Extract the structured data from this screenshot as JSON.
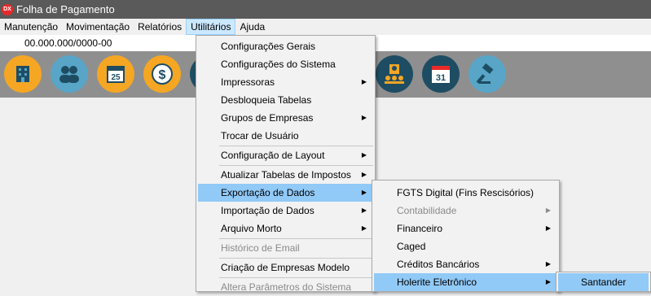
{
  "window": {
    "title": "Folha de Pagamento",
    "icon_text": "DX"
  },
  "menubar": {
    "items": [
      "Manutenção",
      "Movimentação",
      "Relatórios",
      "Utilitários",
      "Ajuda"
    ]
  },
  "company_id": "00.000.000/0000-00",
  "toolbar": {
    "icons": [
      {
        "name": "company-icon",
        "color": "#f5a623"
      },
      {
        "name": "employees-icon",
        "color": "#58a5c7"
      },
      {
        "name": "calendar-25-icon",
        "color": "#f5a623",
        "text": "25"
      },
      {
        "name": "payment-icon",
        "color": "#f5a623",
        "text": "$"
      },
      {
        "name": "partial-icon",
        "color": "#1e4d63"
      },
      {
        "name": "meeting-icon",
        "color": "#1e4d63"
      },
      {
        "name": "calendar-31-icon",
        "color": "#1e4d63",
        "text": "31"
      },
      {
        "name": "gavel-icon",
        "color": "#58a5c7"
      }
    ]
  },
  "utilitarios_menu": {
    "items": [
      {
        "label": "Configurações Gerais"
      },
      {
        "label": "Configurações do Sistema"
      },
      {
        "label": "Impressoras",
        "submenu": true
      },
      {
        "label": "Desbloqueia Tabelas"
      },
      {
        "label": "Grupos de Empresas",
        "submenu": true
      },
      {
        "label": "Trocar de Usuário"
      },
      {
        "label": "Configuração de Layout",
        "submenu": true
      },
      {
        "label": "Atualizar Tabelas de Impostos",
        "submenu": true
      },
      {
        "label": "Exportação de Dados",
        "submenu": true,
        "highlighted": true
      },
      {
        "label": "Importação de Dados",
        "submenu": true
      },
      {
        "label": "Arquivo Morto",
        "submenu": true
      },
      {
        "label": "Histórico de Email",
        "disabled": true
      },
      {
        "label": "Criação de Empresas Modelo"
      },
      {
        "label": "Altera Parâmetros do Sistema",
        "disabled": true
      }
    ]
  },
  "exportacao_menu": {
    "items": [
      {
        "label": "FGTS Digital  (Fins Rescisórios)"
      },
      {
        "label": "Contabilidade",
        "submenu": true,
        "disabled": true
      },
      {
        "label": "Financeiro",
        "submenu": true
      },
      {
        "label": "Caged"
      },
      {
        "label": "Créditos Bancários",
        "submenu": true
      },
      {
        "label": "Holerite Eletrônico",
        "submenu": true,
        "highlighted": true
      }
    ]
  },
  "holerite_menu": {
    "items": [
      {
        "label": "Santander",
        "highlighted": true
      }
    ]
  },
  "accent_colors": {
    "highlight": "#91c9f7",
    "menu_active": "#cce8ff",
    "titlebar": "#5a5a5a",
    "toolbar": "#8f8f8f"
  }
}
